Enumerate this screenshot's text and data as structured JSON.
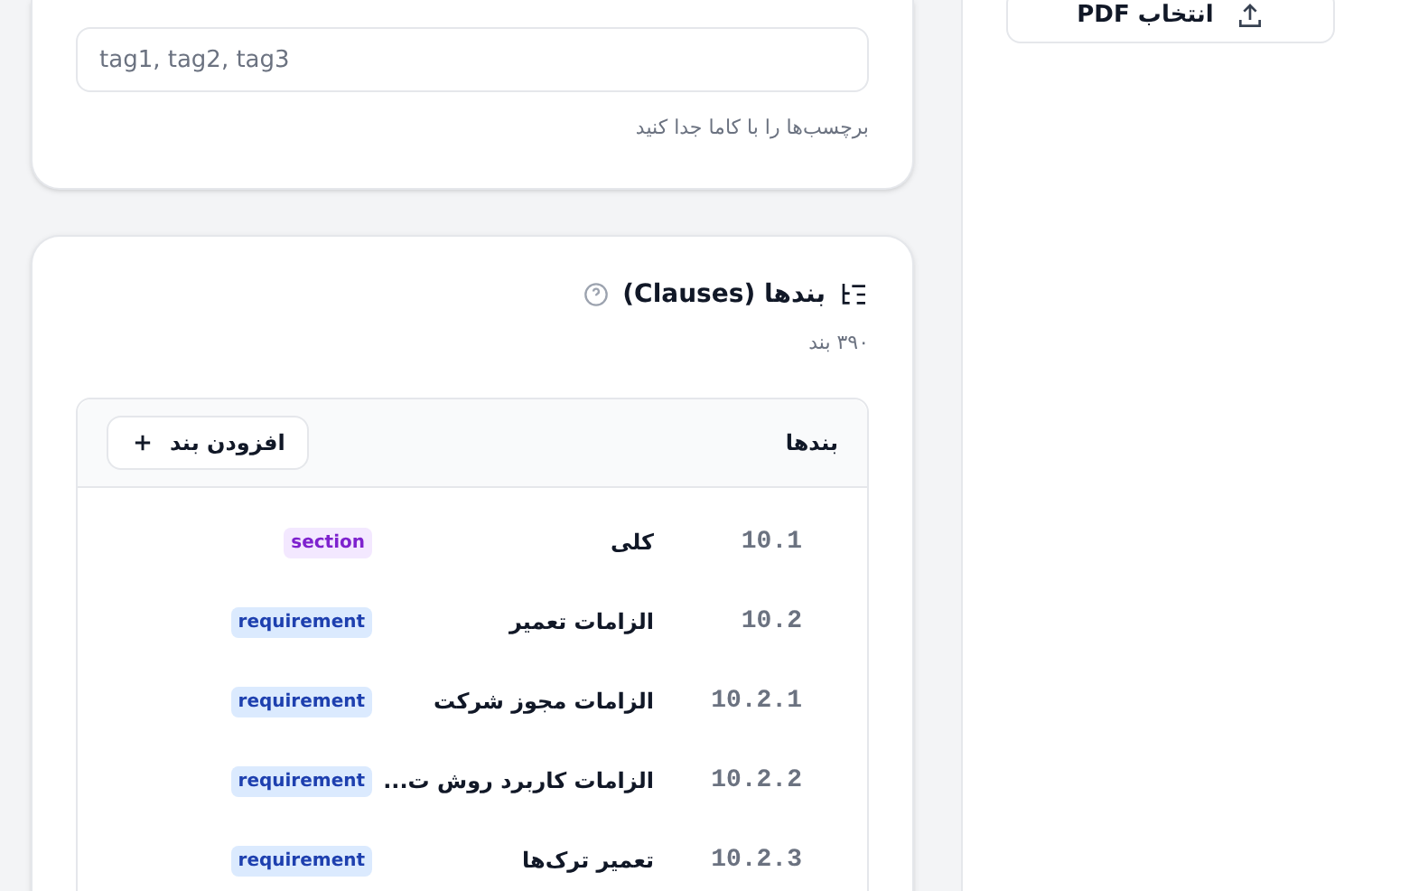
{
  "sidebar": {
    "upload_button": "انتخاب PDF"
  },
  "tags_card": {
    "input": {
      "placeholder": "tag1, tag2, tag3"
    },
    "hint": "برچسب‌ها را با کاما جدا کنید"
  },
  "clauses_card": {
    "title": "بندها (Clauses)",
    "count": "۳۹۰ بند",
    "table": {
      "title": "بندها",
      "add_button": "افزودن بند",
      "rows": [
        {
          "number": "10.1",
          "title": "کلی",
          "tag": "section",
          "kind": "section"
        },
        {
          "number": "10.2",
          "title": "الزامات تعمیر",
          "tag": "requirement",
          "kind": "requirement"
        },
        {
          "number": "10.2.1",
          "title": "الزامات مجوز شرکت",
          "tag": "requirement",
          "kind": "requirement"
        },
        {
          "number": "10.2.2",
          "title": "الزامات کاربرد روش ت...",
          "tag": "requirement",
          "kind": "requirement"
        },
        {
          "number": "10.2.3",
          "title": "تعمیر ترک‌ها",
          "tag": "requirement",
          "kind": "requirement"
        }
      ]
    }
  }
}
